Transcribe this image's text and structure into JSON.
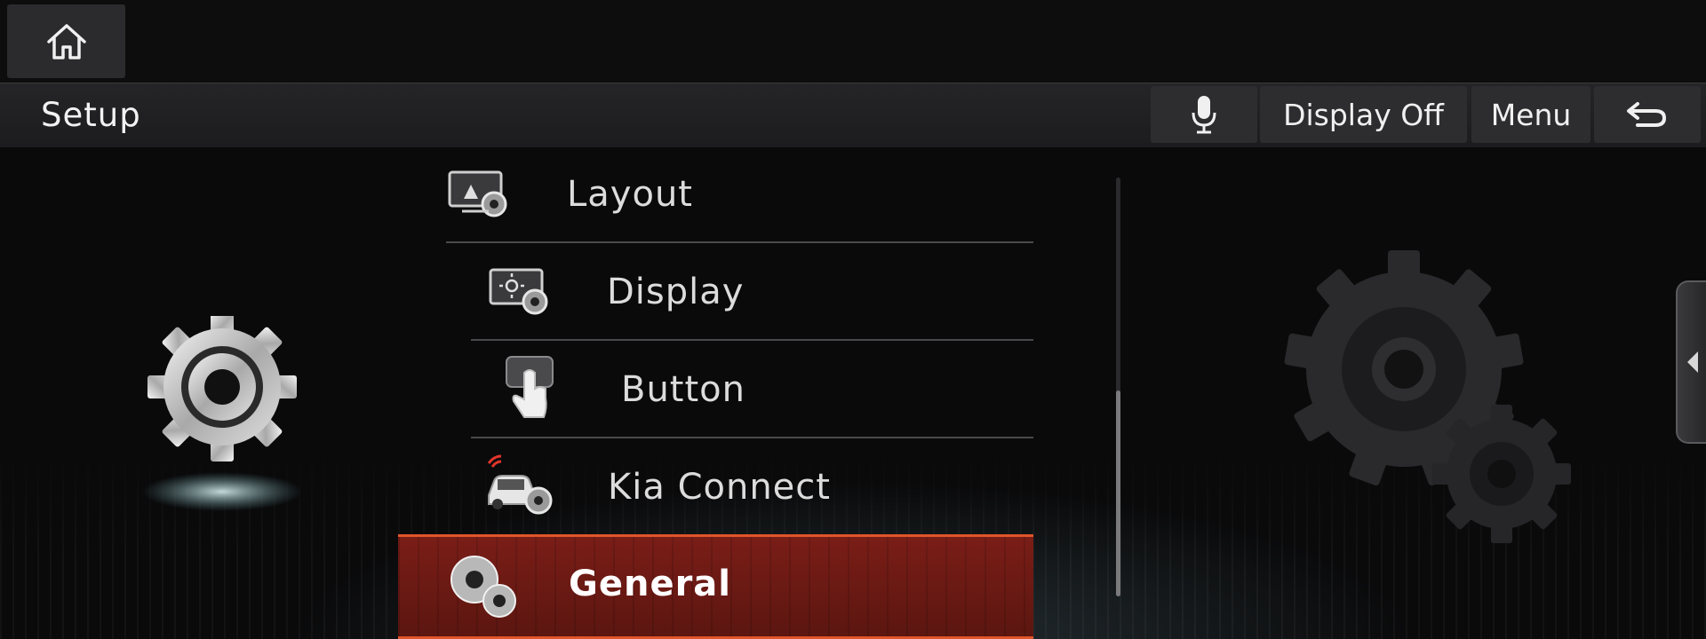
{
  "topbar": {
    "home_icon": "home-icon"
  },
  "header": {
    "title": "Setup",
    "voice_icon": "microphone-icon",
    "display_off_label": "Display Off",
    "menu_label": "Menu",
    "back_icon": "back-arrow-icon"
  },
  "menu": {
    "items": [
      {
        "label": "Layout",
        "icon": "layout-settings-icon"
      },
      {
        "label": "Display",
        "icon": "display-settings-icon"
      },
      {
        "label": "Button",
        "icon": "button-touch-icon"
      },
      {
        "label": "Kia Connect",
        "icon": "kia-connect-car-icon"
      },
      {
        "label": "General",
        "icon": "general-gears-icon",
        "selected": true
      }
    ],
    "scroll_fraction": 0.58
  },
  "colors": {
    "accent": "#e0552a",
    "selected_bg": "#6a1a14"
  }
}
